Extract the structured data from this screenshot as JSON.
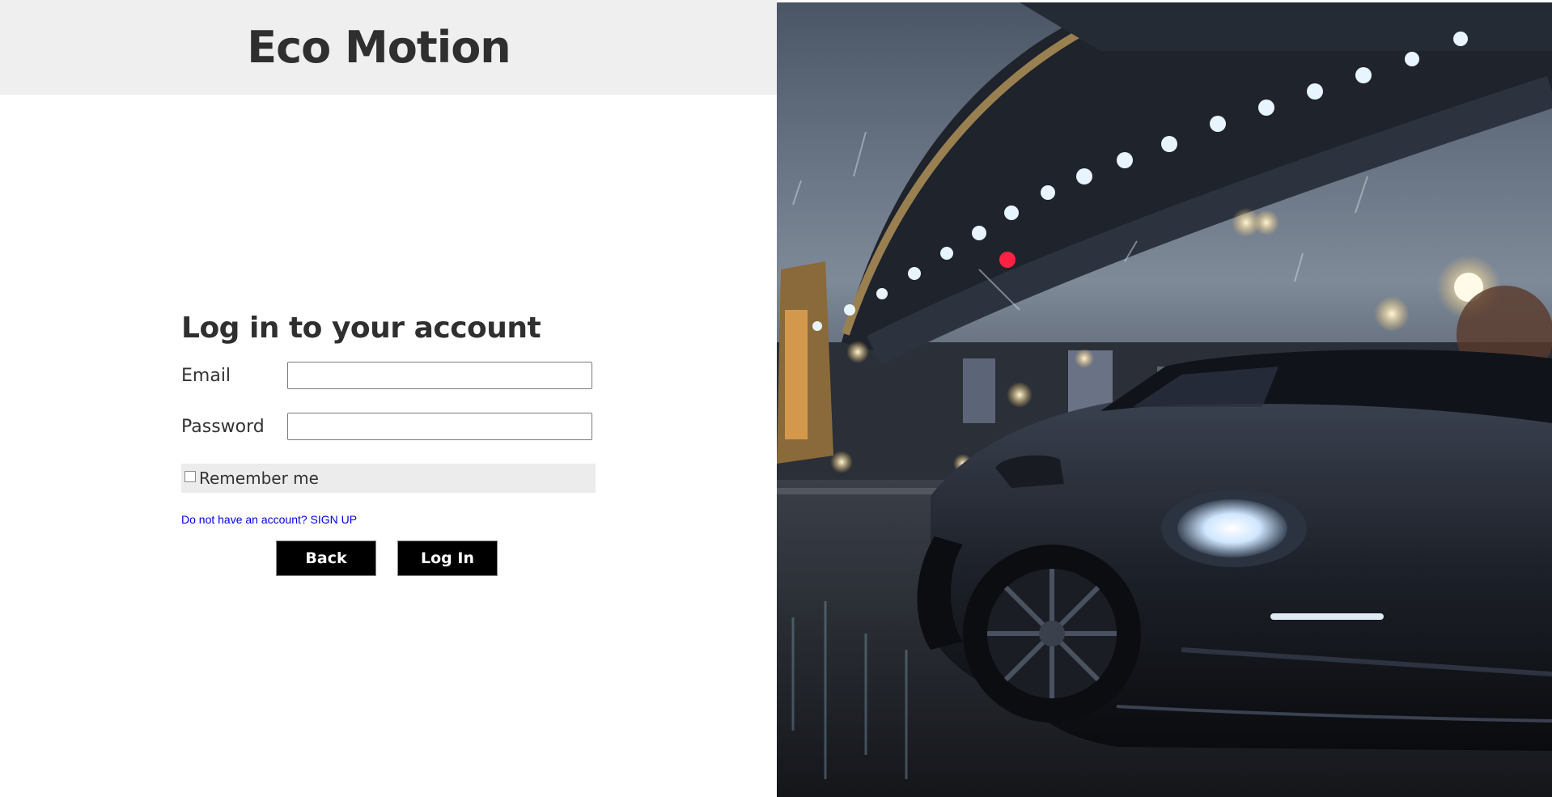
{
  "brand": {
    "title": "Eco Motion"
  },
  "login": {
    "heading": "Log in to your account",
    "email_label": "Email",
    "email_value": "",
    "password_label": "Password",
    "password_value": "",
    "remember_label": "Remember me",
    "remember_checked": false,
    "signup_link": "Do not have an account? SIGN UP",
    "back_button": "Back",
    "login_button": "Log In"
  },
  "hero_image": {
    "description_icon": "photo-car-under-bridge-at-night"
  },
  "colors": {
    "header_bg": "#efefef",
    "text_dark": "#2f2f2f",
    "button_bg": "#000000",
    "button_text": "#ffffff",
    "link": "#0000ee",
    "remember_bg": "#ececec"
  }
}
